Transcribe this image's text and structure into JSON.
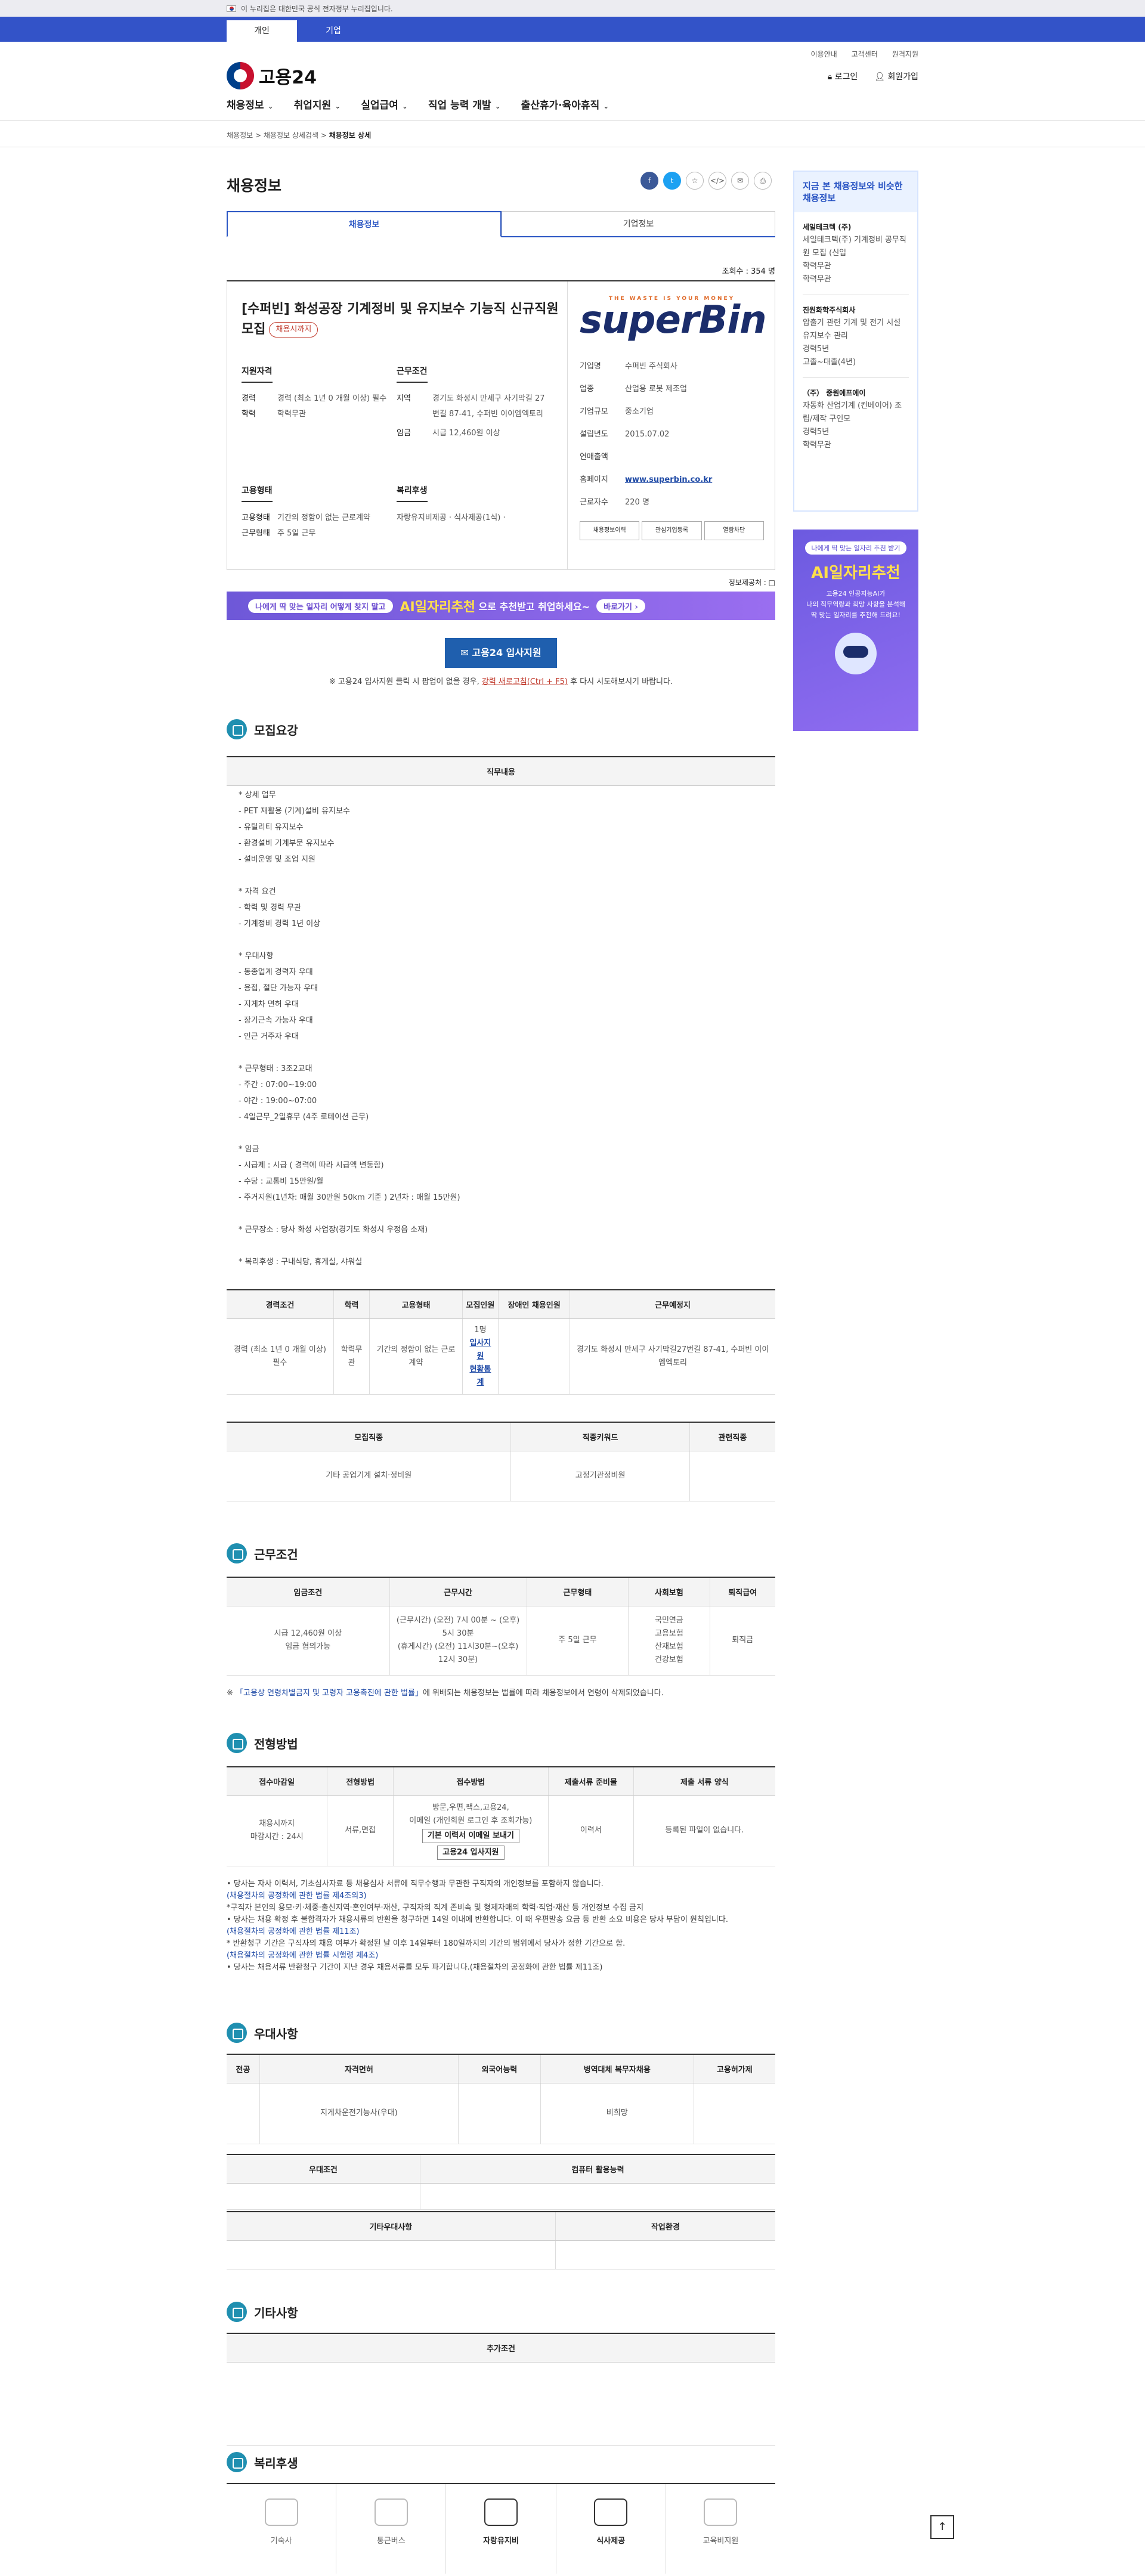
{
  "gov_banner": "이 누리집은 대한민국 공식 전자정부 누리집입니다.",
  "user_types": [
    "개인",
    "기업"
  ],
  "util_links": [
    "이용안내",
    "고객센터",
    "원격지원"
  ],
  "brand": "고용24",
  "auth": {
    "login": "로그인",
    "signup": "회원가입"
  },
  "gnb": [
    "채용정보",
    "취업지원",
    "실업급여",
    "직업 능력 개발",
    "출산휴가·육아휴직"
  ],
  "breadcrumb": {
    "a": "채용정보",
    "b": "채용정보 상세검색",
    "c": "채용정보 상세"
  },
  "page_title": "채용정보",
  "share": {
    "fb": "f",
    "tw": "t",
    "fav": "☆",
    "embed": "</>",
    "mail": "✉",
    "print": "⎙"
  },
  "tabs": [
    "채용정보",
    "기업정보"
  ],
  "views": "조회수 : 354 명",
  "job": {
    "title": "[수퍼빈] 화성공장 기계정비 및 유지보수 기능직 신규직원 모집",
    "badge": "채용시까지",
    "qual_h": "지원자격",
    "cond_h": "근무조건",
    "career_k": "경력",
    "career_v": "경력 (최소 1년 0 개월 이상) 필수",
    "edu_k": "학력",
    "edu_v": "학력무관",
    "loc_k": "지역",
    "loc_v": "경기도 화성시 만세구 사기막길 27번길 87-41, 수퍼빈 이이엠엑토리",
    "pay_k": "임금",
    "pay_v": "시급 12,460원 이상",
    "emp_h": "고용형태",
    "welfare_h": "복리후생",
    "emptype_k": "고용형태",
    "emptype_v": "기간의 정함이 없는 근로계약",
    "hours_k": "근무형태",
    "hours_v": "주 5일 근무",
    "welfare_v": "자랑유지비제공 · 식사제공(1식) ·"
  },
  "company": {
    "logo_tag": "THE WASTE IS YOUR MONEY",
    "logo": "superBin",
    "rows": [
      [
        "기업명",
        "수퍼빈 주식회사"
      ],
      [
        "업종",
        "산업용 로봇 제조업"
      ],
      [
        "기업규모",
        "중소기업"
      ],
      [
        "설립년도",
        "2015.07.02"
      ],
      [
        "연매출액",
        ""
      ],
      [
        "홈페이지",
        "www.superbin.co.kr"
      ],
      [
        "근로자수",
        "220 명"
      ]
    ],
    "btns": [
      "채용정보이력",
      "관심기업등록",
      "열람차단"
    ]
  },
  "pub_hint": "정보제공처 : □",
  "ai_banner": {
    "pill": "나에게 딱 맞는 일자리 어떻게 찾지 말고",
    "hi": "AI일자리추천",
    "rest": "으로 추천받고 취업하세요~",
    "more": "바로가기 ›"
  },
  "apply_btn": "고용24 입사지원",
  "apply_note_a": "※ 고용24 입사지원 클릭 시 팝업이 없을 경우, ",
  "apply_note_link": "강력 새로고침(Ctrl + F5)",
  "apply_note_b": " 후 다시 시도해보시기 바랍니다.",
  "sections": {
    "recruit": "모집요강",
    "work": "근무조건",
    "select": "전형방법",
    "prefer": "우대사항",
    "etc": "기타사항",
    "welfare": "복리후생"
  },
  "duty_th": "직무내용",
  "duty_text": "* 상세 업무\n- PET 재활용 (기계)설비 유지보수\n- 유틸리티 유지보수\n- 환경설비 기계부문 유지보수\n- 설비운영 및 조업 지원\n\n* 자격 요건\n- 학력 및 경력 무관\n- 기계정비 경력 1년 이상\n\n* 우대사항\n- 동종업계 경력자 우대\n- 용접, 절단 가능자 우대\n- 지게차 면허 우대\n- 장기근속 가능자 우대\n- 인근 거주자 우대\n\n* 근무형태 : 3조2교대\n- 주간 : 07:00~19:00\n- 야간 : 19:00~07:00\n- 4일근무_2일휴무 (4주 로테이션 근무)\n\n* 임금\n- 시급제 : 시급 ( 경력에 따라 시급액 변동함)\n- 수당 : 교통비 15만원/월\n- 주거지원(1년차: 매월 30만원 50km 기준 ) 2년차 : 매월 15만원)\n\n* 근무장소 : 당사 화성 사업장(경기도 화성시 우정읍 소재)\n\n* 복리후생 : 구내식당, 휴게실, 샤워실",
  "recruit_table": {
    "head": [
      "경력조건",
      "학력",
      "고용형태",
      "모집인원",
      "장애인 채용인원",
      "근무예정지"
    ],
    "row": [
      "경력 (최소 1년 0 개월 이상) 필수",
      "학력무관",
      "기간의 정함이 없는 근로계약",
      "1명",
      "",
      "경기도 화성시 만세구 사기막길27번길 87-41, 수퍼빈 이이엠엑토리"
    ],
    "links": [
      "입사지원",
      "현황통계"
    ]
  },
  "job_table": {
    "head": [
      "모집직종",
      "직종키워드",
      "관련직종"
    ],
    "row": [
      "기타 공업기계 설치·정비원",
      "고정기관정비원",
      ""
    ]
  },
  "work_table": {
    "head": [
      "임금조건",
      "근무시간",
      "근무형태",
      "사회보험",
      "퇴직급여"
    ],
    "row": [
      "시급 12,460원 이상\n임금 협의가능",
      "(근무시간) (오전) 7시 00분 ~ (오후) 5시 30분\n(휴게시간) (오전) 11시30분~(오후) 12시 30분)",
      "주 5일 근무",
      "국민연금\n고용보험\n산재보험\n건강보험",
      "퇴직금"
    ]
  },
  "work_note_a": "※ ",
  "work_note_link": "「고용상 연령차별금지 및 고령자 고용촉진에 관한 법률」",
  "work_note_b": "에 위배되는 채용정보는 법률에 따라 채용정보에서 연령이 삭제되었습니다.",
  "select_table": {
    "head": [
      "접수마감일",
      "전형방법",
      "접수방법",
      "제출서류 준비물",
      "제출 서류 양식"
    ],
    "row": [
      "채용시까지\n마감시간 : 24시",
      "서류,면접",
      "방문,우편,팩스,고용24,\n이메일 (개인회원 로그인 후 조회가능)",
      "이력서",
      "등록된 파일이 없습니다."
    ],
    "btns": [
      "기본 이력서 이메일 보내기",
      "고용24 입사지원"
    ]
  },
  "select_notes": [
    "• 당사는 자사 이력서, 기초심사자료 등 채용심사 서류에 직무수행과 무관한 구직자의 개인정보를 포함하지 않습니다.",
    "(채용절차의 공정화에 관한 법률 제4조의3)",
    "*구직자 본인의 용모·키·체중·출신지역·혼인여부·재산, 구직자의 직계 존비속 및 형제자매의 학력·직업·재산 등 개인정보 수집 금지",
    "• 당사는 채용 확정 후 불합격자가 채용서류의 반환을 청구하면 14일 이내에 반환합니다. 이 때 우편발송 요금 등 반환 소요 비용은 당사 부담이 원칙입니다.",
    "(채용절차의 공정화에 관한 법률 제11조)",
    "* 반환청구 기간은 구직자의 채용 여부가 확정된 날 이후 14일부터 180일까지의 기간의 범위에서 당사가 정한 기간으로 함.",
    "(채용절차의 공정화에 관한 법률 시행령 제4조)",
    "• 당사는 채용서류 반환청구 기간이 지난 경우 채용서류를 모두 파기합니다.(채용절차의 공정화에 관한 법률 제11조)"
  ],
  "prefer_table": {
    "head": [
      "전공",
      "자격면허",
      "외국어능력",
      "병역대체 복무자채용",
      "고용허가제"
    ],
    "row": [
      "",
      "지게차운전기능사(우대)",
      "",
      "비희망",
      ""
    ]
  },
  "prefer2": {
    "head": [
      "우대조건",
      "컴퓨터 활용능력"
    ]
  },
  "prefer3": {
    "head": [
      "기타우대사항",
      "작업환경"
    ]
  },
  "etc_th": "추가조건",
  "welfare_items": [
    "기숙사",
    "통근버스",
    "자랑유지비",
    "식사제공",
    "교육비지원"
  ],
  "aside": {
    "title": "지금 본 채용정보와 비슷한 채용정보",
    "recs": [
      {
        "co": "세일테크텍 (주)",
        "t": "세일테크텍(주) 기계정비 공무직원 모집 (신입",
        "c": "학력무관",
        "e": "학력무관"
      },
      {
        "co": "진원화학주식회사",
        "t": "압출기 관련 기계 및 전기 시설 유지보수 관리",
        "c": "경력5년",
        "e": "고졸~대졸(4년)"
      },
      {
        "co": "（주） 중원에프에이",
        "t": "자동화 산업기계 (컨베이어) 조립/제작 구인모",
        "c": "경력5년",
        "e": "학력무관"
      }
    ],
    "banner": {
      "p": "나에게 딱 맞는 일자리 추천 받기",
      "big": "AI일자리추천",
      "sm": "고용24 인공지능AI가\n나의 직무역량과 희망 사항을 분석해\n딱 맞는 일자리를 추천해 드려요!"
    }
  },
  "top_btn": "↑"
}
